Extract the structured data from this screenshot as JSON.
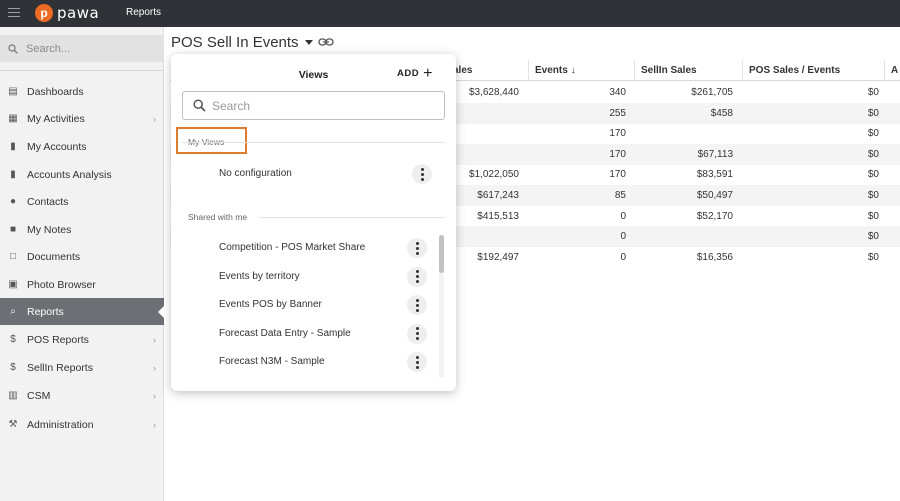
{
  "topbar": {
    "logo_text": "pawa",
    "logo_mark": "p",
    "section": "Reports"
  },
  "sidebar": {
    "search_placeholder": "Search...",
    "items": [
      {
        "label": "Dashboards",
        "icon": "dashboard-icon",
        "chevron": false
      },
      {
        "label": "My Activities",
        "icon": "calendar-icon",
        "chevron": true
      },
      {
        "label": "My Accounts",
        "icon": "building-icon",
        "chevron": false
      },
      {
        "label": "Accounts Analysis",
        "icon": "building-icon",
        "chevron": false
      },
      {
        "label": "Contacts",
        "icon": "person-icon",
        "chevron": false
      },
      {
        "label": "My Notes",
        "icon": "note-icon",
        "chevron": false
      },
      {
        "label": "Documents",
        "icon": "documents-icon",
        "chevron": false
      },
      {
        "label": "Photo Browser",
        "icon": "image-icon",
        "chevron": false
      },
      {
        "label": "Reports",
        "icon": "search-report-icon",
        "chevron": false,
        "active": true
      },
      {
        "label": "POS Reports",
        "icon": "dollar-icon",
        "chevron": true
      },
      {
        "label": "SellIn Reports",
        "icon": "dollar-icon",
        "chevron": true
      },
      {
        "label": "CSM",
        "icon": "book-icon",
        "chevron": true
      },
      {
        "label": "Administration",
        "icon": "wrench-icon",
        "chevron": true
      }
    ]
  },
  "page": {
    "title": "POS Sell In Events"
  },
  "table": {
    "headers": [
      "ales",
      "Events ↓",
      "SellIn Sales",
      "POS Sales / Events",
      "A"
    ],
    "rows": [
      [
        "$3,628,440",
        "340",
        "$261,705",
        "$0"
      ],
      [
        "",
        "255",
        "$458",
        "$0"
      ],
      [
        "",
        "170",
        "",
        "$0"
      ],
      [
        "",
        "170",
        "$67,113",
        "$0"
      ],
      [
        "$1,022,050",
        "170",
        "$83,591",
        "$0"
      ],
      [
        "$617,243",
        "85",
        "$50,497",
        "$0"
      ],
      [
        "$415,513",
        "0",
        "$52,170",
        "$0"
      ],
      [
        "",
        "0",
        "",
        "$0"
      ],
      [
        "$192,497",
        "0",
        "$16,356",
        "$0"
      ]
    ]
  },
  "views_panel": {
    "title": "Views",
    "add_label": "ADD",
    "search_placeholder": "Search",
    "my_views_label": "My Views",
    "my_views": [
      "No configuration"
    ],
    "shared_label": "Shared with me",
    "shared": [
      "Competition - POS Market Share",
      "Events by territory",
      "Events POS by Banner",
      "Forecast Data Entry - Sample",
      "Forecast N3M - Sample"
    ]
  },
  "colors": {
    "brand": "#ec6a24",
    "topbar": "#2f3237",
    "active_nav": "#6c6f74",
    "highlight": "#e07a2e"
  }
}
